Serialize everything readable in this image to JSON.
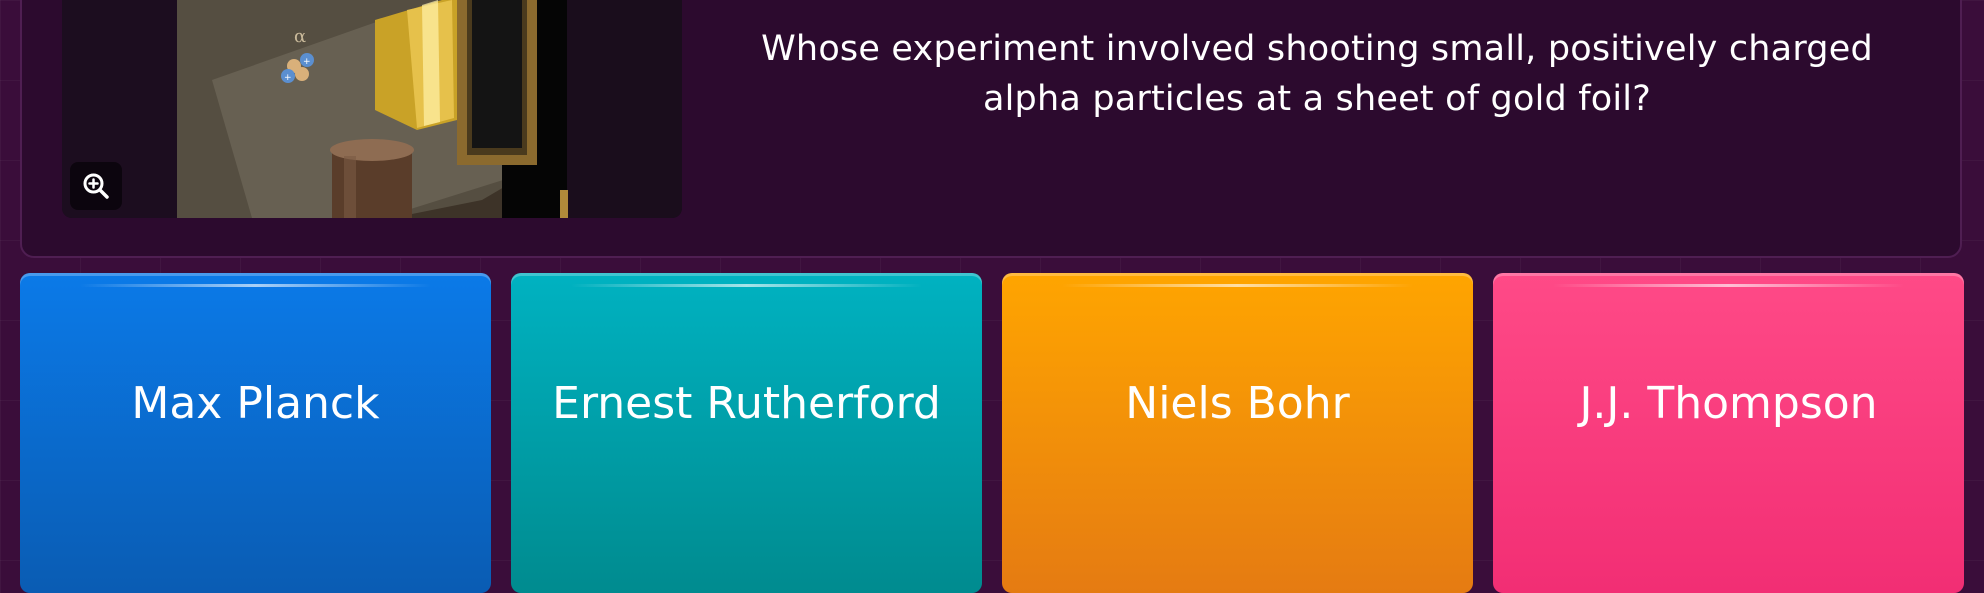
{
  "question": {
    "text": "Whose experiment involved shooting small, positively charged alpha particles at a sheet of gold foil?",
    "image": {
      "alpha_symbol": "α",
      "zoom_icon": "zoom-in-icon"
    }
  },
  "options": [
    {
      "label": "Max Planck",
      "color": "#0b7ae8"
    },
    {
      "label": "Ernest Rutherford",
      "color": "#00b2c1"
    },
    {
      "label": "Niels Bohr",
      "color": "#ffa500"
    },
    {
      "label": "J.J. Thompson",
      "color": "#ff4a87"
    }
  ]
}
